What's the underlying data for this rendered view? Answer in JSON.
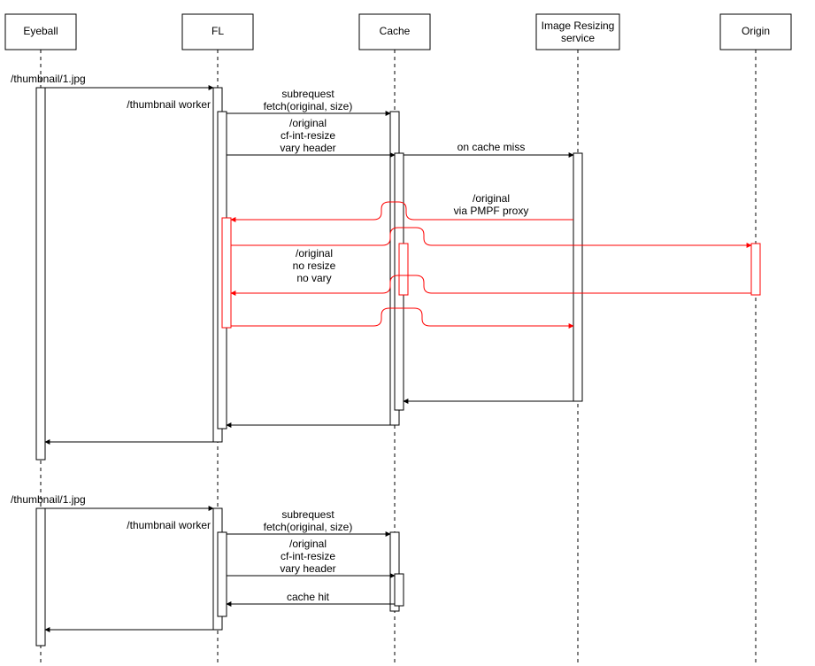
{
  "participants": {
    "eyeball": {
      "label": "Eyeball"
    },
    "fl": {
      "label": "FL"
    },
    "cache": {
      "label": "Cache"
    },
    "irs": {
      "label_line1": "Image Resizing",
      "label_line2": "service"
    },
    "origin": {
      "label": "Origin"
    }
  },
  "messages": {
    "req1": "/thumbnail/1.jpg",
    "worker": "/thumbnail worker",
    "subrequest_l1": "subrequest",
    "subrequest_l2": "fetch(original, size)",
    "tocache_l1": "/original",
    "tocache_l2": "cf-int-resize",
    "tocache_l3": "vary header",
    "cachemiss": "on cache miss",
    "pmpf_l1": "/original",
    "pmpf_l2": "via PMPF proxy",
    "noresize_l1": "/original",
    "noresize_l2": "no resize",
    "noresize_l3": "no vary",
    "req2": "/thumbnail/1.jpg",
    "worker2": "/thumbnail worker",
    "cachehit": "cache hit"
  }
}
